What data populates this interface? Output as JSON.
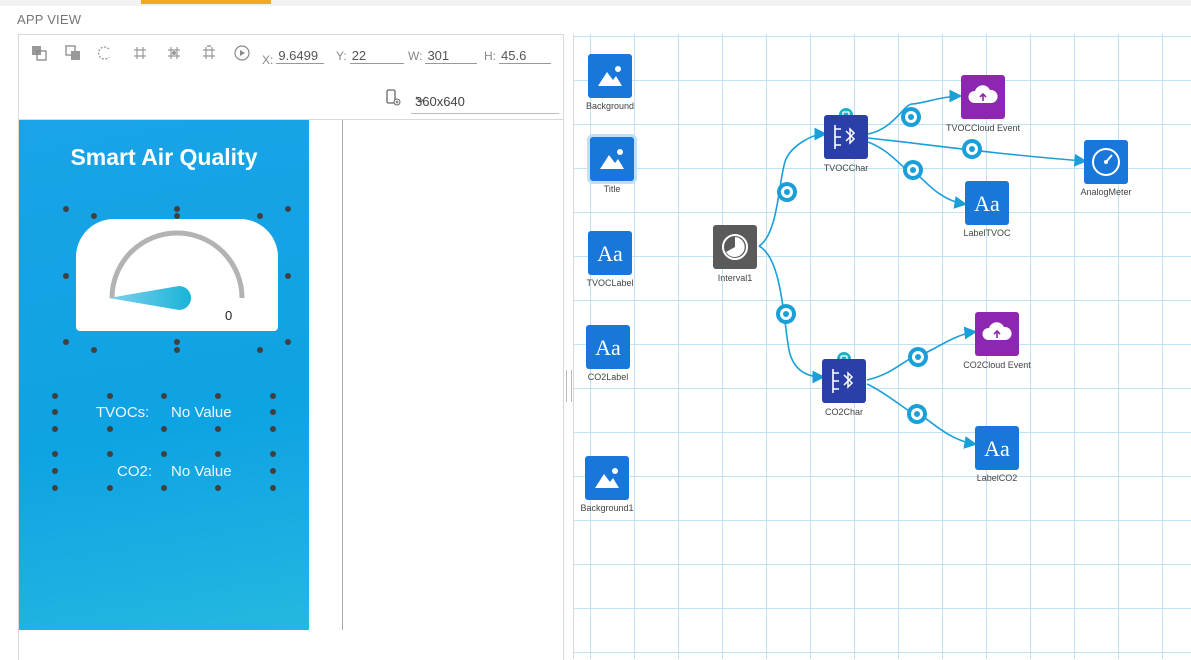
{
  "panel_title": "APP VIEW",
  "toolbar": {
    "x_label": "X:",
    "x_value": "9.6499",
    "y_label": "Y:",
    "y_value": "22",
    "w_label": "W:",
    "w_value": "301",
    "h_label": "H:",
    "h_value": "45.6",
    "device_size": "360x640",
    "icons": [
      "bring-front-icon",
      "send-back-icon",
      "rotate-icon",
      "grid-icon",
      "grid-snap-icon",
      "grid-settings-icon",
      "play-icon",
      "device-preview-icon"
    ]
  },
  "phone": {
    "title": "Smart Air Quality",
    "gauge_value": "0",
    "gauge_level": 0,
    "tvoc_label": "TVOCs:",
    "tvoc_value": "No Value",
    "co2_label": "CO2:",
    "co2_value": "No Value"
  },
  "canvas": {
    "nodes": {
      "background": "Background",
      "title": "Title",
      "tvoclabel": "TVOCLabel",
      "co2label": "CO2Label",
      "background1": "Background1",
      "interval1": "Interval1",
      "tvocchar": "TVOCChar",
      "co2char": "CO2Char",
      "tvoccloudevent": "TVOCCloud Event",
      "co2cloudevent": "CO2Cloud Event",
      "analogmeter": "AnalogMeter",
      "labeltvoc": "LabelTVOC",
      "labelco2": "LabelCO2"
    }
  },
  "colors": {
    "accent": "#f5a623",
    "phone_bg": "#0ea3e3",
    "node_blue": "#1877d8",
    "node_navy": "#2b3fa8",
    "node_purple": "#8d26b0",
    "node_gray": "#5a5a5a",
    "edge": "#1a9fd8"
  }
}
